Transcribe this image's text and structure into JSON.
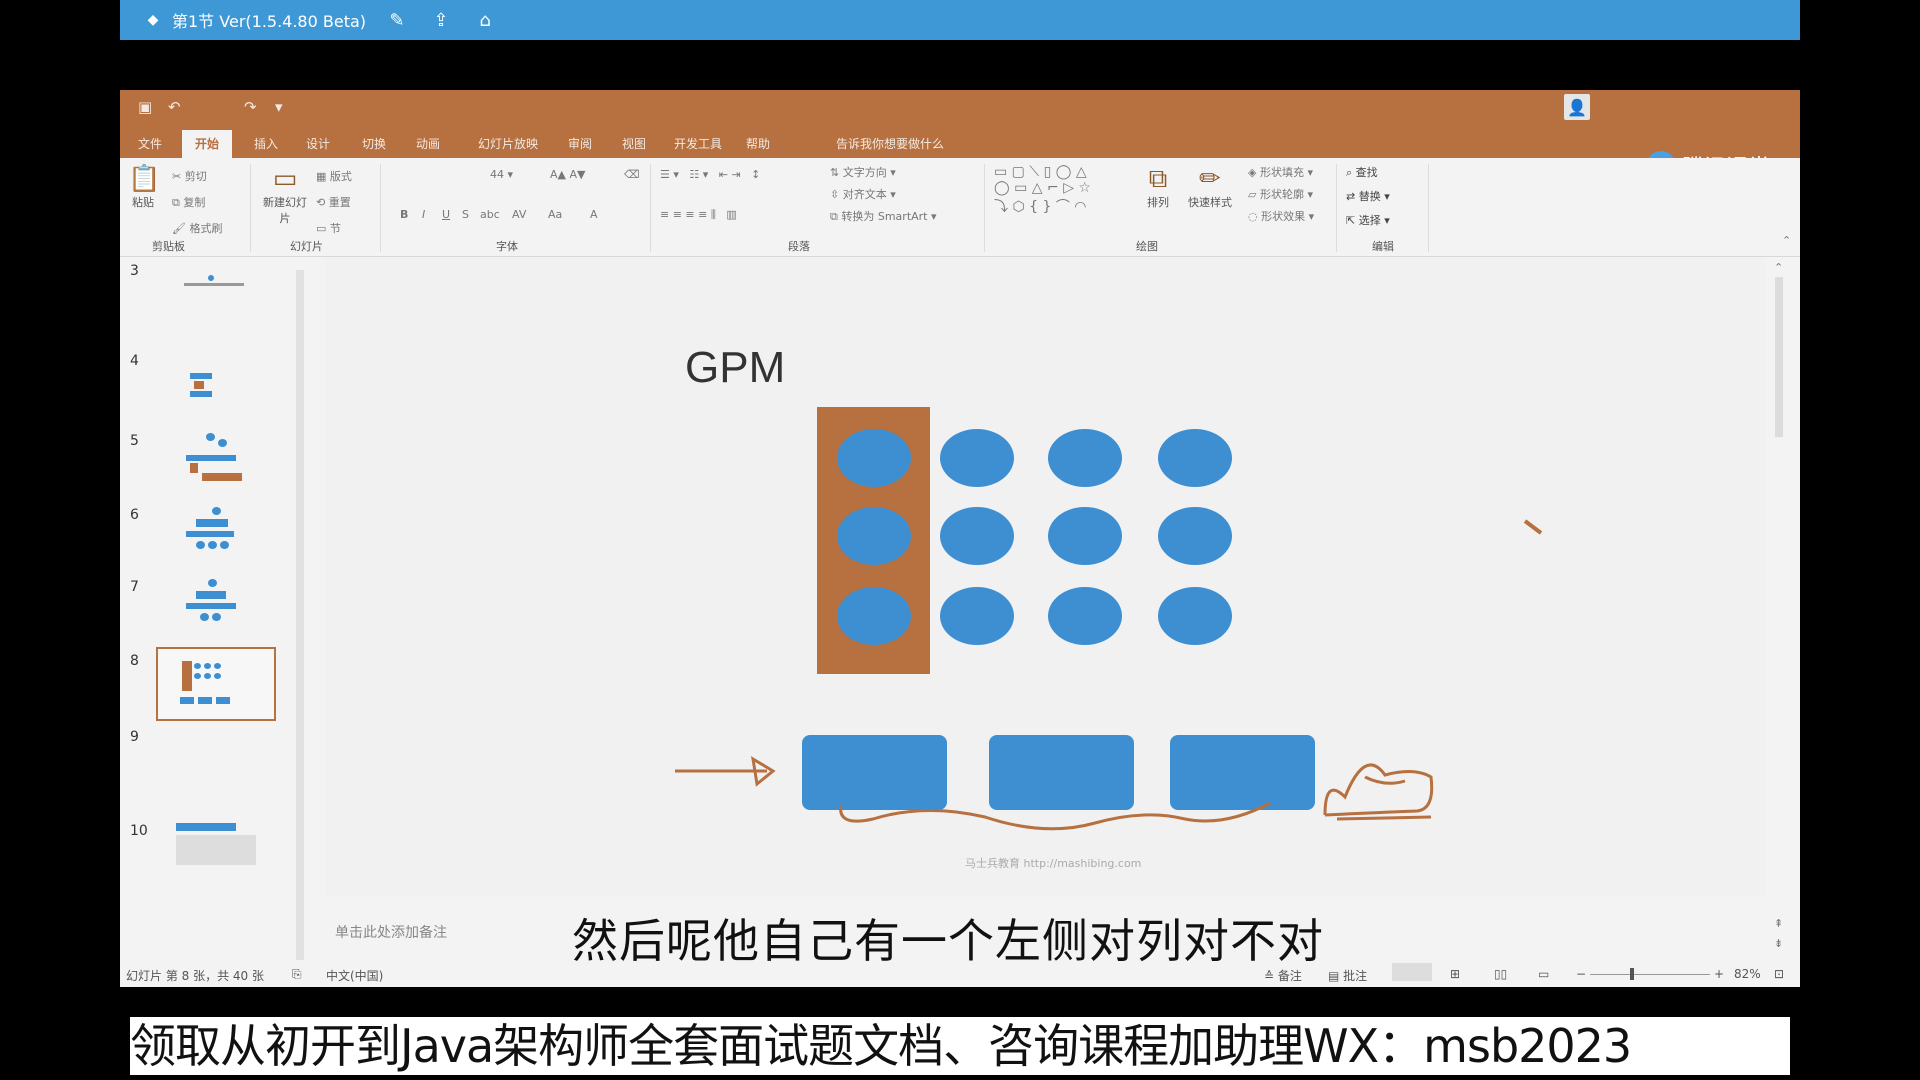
{
  "player": {
    "title": "第1节 Ver(1.5.4.80 Beta)",
    "icons": [
      "logo-icon",
      "edit-icon",
      "share-icon",
      "home-icon"
    ]
  },
  "ppt": {
    "tabs": [
      "文件",
      "开始",
      "插入",
      "设计",
      "切换",
      "动画",
      "幻灯片放映",
      "审阅",
      "视图",
      "开发工具",
      "帮助",
      "告诉我你想要做什么"
    ],
    "active_tab": "开始",
    "brand": {
      "name": "腾讯课堂",
      "suffix": "共享"
    },
    "ribbon": {
      "clipboard": {
        "paste": "粘贴",
        "cut": "剪切",
        "copy": "复制",
        "format_painter": "格式刷",
        "label": "剪贴板"
      },
      "slides": {
        "new_slide": "新建幻灯片",
        "layout": "版式",
        "reset": "重置",
        "section": "节",
        "label": "幻灯片"
      },
      "font": {
        "size": "44",
        "label": "字体",
        "buttons": [
          "B",
          "I",
          "U",
          "S",
          "abc",
          "AV",
          "Aa",
          "A"
        ]
      },
      "paragraph": {
        "text_direction": "文字方向",
        "align_text": "对齐文本",
        "smartart": "转换为 SmartArt",
        "label": "段落"
      },
      "drawing": {
        "arrange": "排列",
        "quick_styles": "快速样式",
        "shape_fill": "形状填充",
        "shape_outline": "形状轮廓",
        "shape_effects": "形状效果",
        "label": "绘图"
      },
      "editing": {
        "find": "查找",
        "replace": "替换",
        "select": "选择",
        "label": "编辑"
      }
    },
    "slides": [
      3,
      4,
      5,
      6,
      7,
      8,
      9,
      10
    ],
    "selected_slide": 8,
    "slide": {
      "title": "GPM",
      "watermark": "马士兵教育 http://mashibing.com"
    },
    "notes_placeholder": "单击此处添加备注",
    "status": {
      "slide_info": "幻灯片 第 8 张，共 40 张",
      "language": "中文(中国)",
      "notes": "备注",
      "comments": "批注",
      "zoom": "82%"
    }
  },
  "subtitle": "然后呢他自己有一个左侧对列对不对",
  "promo": "领取从初开到Java架构师全套面试题文档、咨询课程加助理WX：msb2023",
  "colors": {
    "player_bar": "#3f98d6",
    "ppt_accent": "#b7703f",
    "shape_blue": "#3d8fd1"
  }
}
